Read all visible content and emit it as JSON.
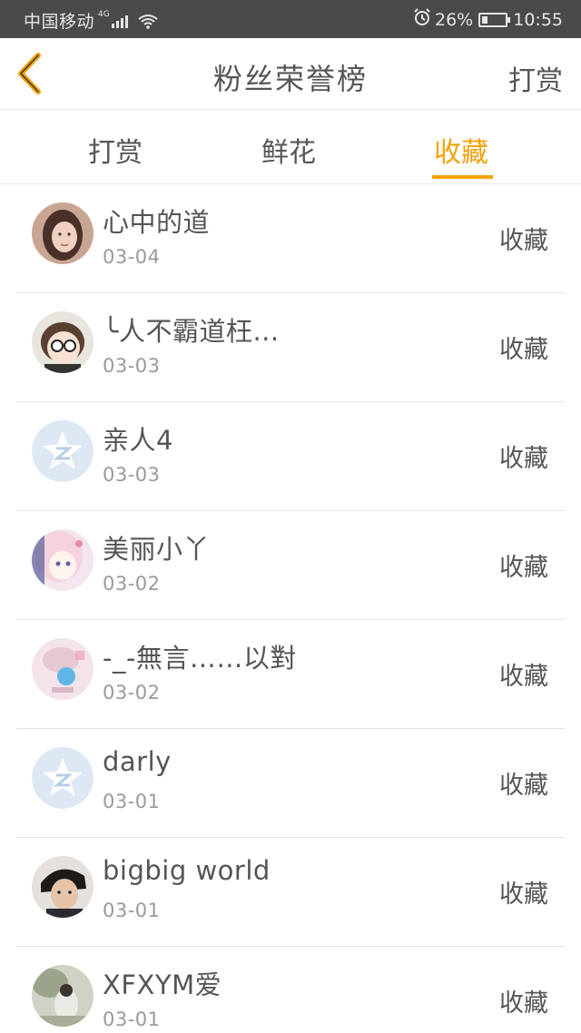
{
  "status_bar": {
    "carrier": "中国移动",
    "network": "4G",
    "battery": "26%",
    "battery_level": 0.26,
    "time": "10:55"
  },
  "nav": {
    "title": "粉丝荣誉榜",
    "right_action": "打赏"
  },
  "tabs": [
    {
      "label": "打赏",
      "active": false
    },
    {
      "label": "鲜花",
      "active": false
    },
    {
      "label": "收藏",
      "active": true
    }
  ],
  "colors": {
    "accent": "#f5a20a",
    "status_bar": "#4a4a4a"
  },
  "fans": [
    {
      "name": "心中的道",
      "date": "03-04",
      "action": "收藏",
      "avatar": "photo-girl"
    },
    {
      "name": "╰人不霸道枉...",
      "date": "03-03",
      "action": "收藏",
      "avatar": "cartoon-glasses"
    },
    {
      "name": "亲人4",
      "date": "03-03",
      "action": "收藏",
      "avatar": "default-qq"
    },
    {
      "name": "美丽小丫",
      "date": "03-02",
      "action": "收藏",
      "avatar": "anime-girl"
    },
    {
      "name": "-_-無言……以對",
      "date": "03-02",
      "action": "收藏",
      "avatar": "blurred-photo"
    },
    {
      "name": "darly",
      "date": "03-01",
      "action": "收藏",
      "avatar": "default-qq"
    },
    {
      "name": "bigbig world",
      "date": "03-01",
      "action": "收藏",
      "avatar": "photo-boy"
    },
    {
      "name": "XFXYM爱",
      "date": "03-01",
      "action": "收藏",
      "avatar": "photo-scenery"
    }
  ]
}
